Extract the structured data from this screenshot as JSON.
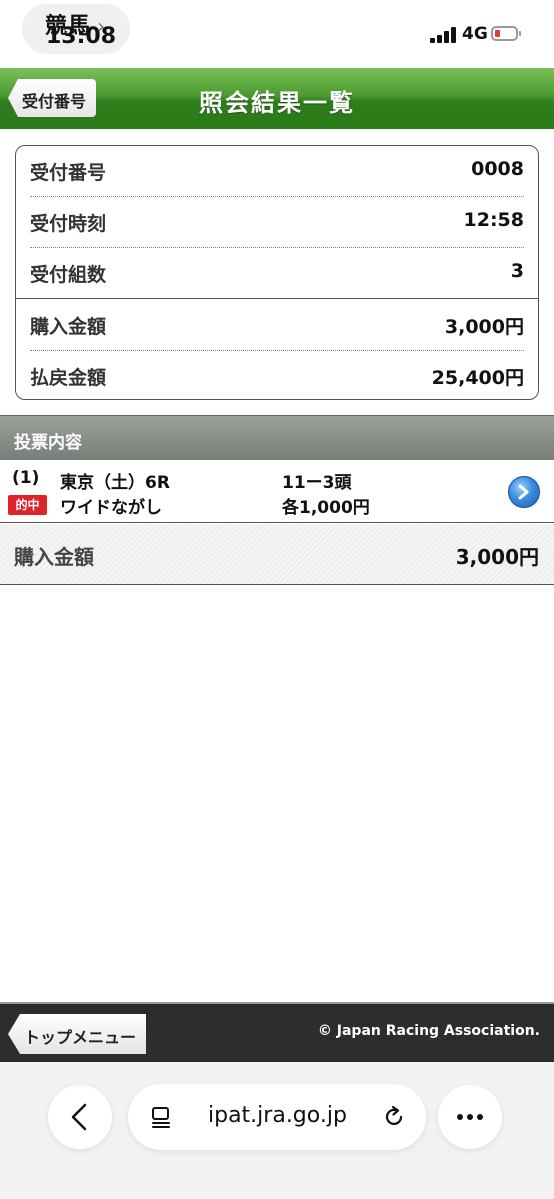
{
  "status_bar": {
    "back_app": "競馬",
    "time": "13:08",
    "network": "4G"
  },
  "header": {
    "back_label": "受付番号",
    "title": "照会結果一覧",
    "color": "#3f8f2a"
  },
  "summary": {
    "rows": [
      {
        "label": "受付番号",
        "value": "0008"
      },
      {
        "label": "受付時刻",
        "value": "12:58"
      },
      {
        "label": "受付組数",
        "value": "3"
      },
      {
        "label": "購入金額",
        "value": "3,000円"
      },
      {
        "label": "払戻金額",
        "value": "25,400円"
      }
    ]
  },
  "section": {
    "title": "投票内容"
  },
  "bet": {
    "number": "(1)",
    "race": "東京（土）6R",
    "combination": "11ー3頭",
    "badge": "的中",
    "type": "ワイドながし",
    "amount": "各1,000円"
  },
  "total": {
    "label": "購入金額",
    "value": "3,000円"
  },
  "footer": {
    "top_menu": "トップメニュー",
    "copyright": "© Japan Racing Association."
  },
  "browser": {
    "url": "ipat.jra.go.jp",
    "icons": [
      "back-icon",
      "page-icon",
      "reload-icon",
      "more-icon"
    ]
  }
}
